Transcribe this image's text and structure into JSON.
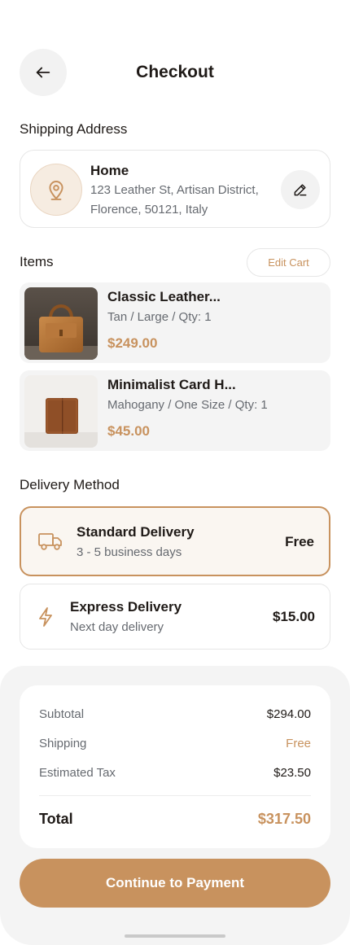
{
  "header": {
    "title": "Checkout",
    "back_icon": "arrow-left-icon"
  },
  "shipping": {
    "section_label": "Shipping Address",
    "name": "Home",
    "line1": "123 Leather St, Artisan District,",
    "line2": "Florence, 50121, Italy",
    "pin_icon": "location-pin-icon",
    "edit_icon": "pencil-icon"
  },
  "items": {
    "section_label": "Items",
    "edit_cart_label": "Edit Cart",
    "list": [
      {
        "name": "Classic Leather...",
        "meta": "Tan / Large / Qty: 1",
        "price": "$249.00"
      },
      {
        "name": "Minimalist Card H...",
        "meta": "Mahogany / One Size / Qty: 1",
        "price": "$45.00"
      }
    ]
  },
  "delivery": {
    "section_label": "Delivery Method",
    "options": [
      {
        "name": "Standard Delivery",
        "sub": "3 - 5 business days",
        "price": "Free",
        "icon": "truck-icon",
        "selected": true
      },
      {
        "name": "Express Delivery",
        "sub": "Next day delivery",
        "price": "$15.00",
        "icon": "lightning-icon",
        "selected": false
      }
    ]
  },
  "summary": {
    "subtotal_label": "Subtotal",
    "subtotal": "$294.00",
    "shipping_label": "Shipping",
    "shipping": "Free",
    "tax_label": "Estimated Tax",
    "tax": "$23.50",
    "total_label": "Total",
    "total": "$317.50"
  },
  "cta": {
    "label": "Continue to Payment"
  },
  "colors": {
    "accent": "#c8925e",
    "accent_bg": "#faf6f1",
    "text": "#1f1a17",
    "muted": "#666a70"
  }
}
